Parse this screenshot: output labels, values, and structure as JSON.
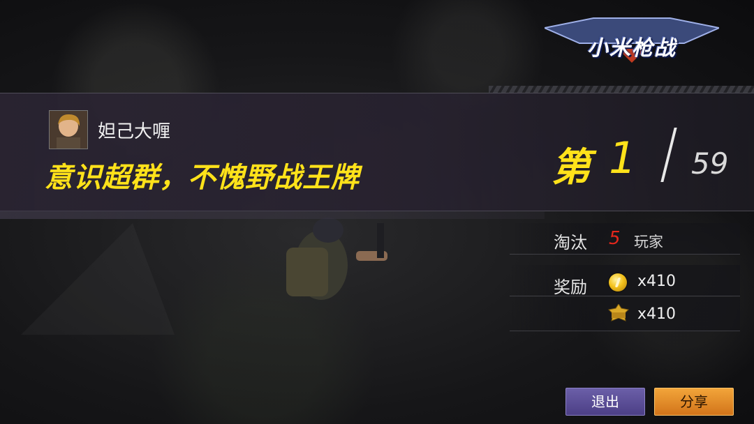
{
  "game": {
    "logo_text": "小米枪战"
  },
  "player": {
    "name": "妲己大喱"
  },
  "result": {
    "slogan": "意识超群，不愧野战王牌",
    "rank_prefix": "第",
    "rank": "1",
    "total_players": "59"
  },
  "stats": {
    "kills_label": "淘汰",
    "kills_value": "5",
    "kills_unit": "玩家",
    "reward_label": "奖励",
    "coin_reward": "x410",
    "exp_reward": "x410"
  },
  "buttons": {
    "exit_label": "退出",
    "share_label": "分享"
  },
  "colors": {
    "accent_yellow": "#ffe21a",
    "kill_red": "#e3271c",
    "exit_purple": "#5a4e98",
    "share_orange": "#e88c2a"
  },
  "icons": {
    "coin": "coin-icon",
    "exp": "exp-badge-icon",
    "avatar": "player-avatar"
  }
}
